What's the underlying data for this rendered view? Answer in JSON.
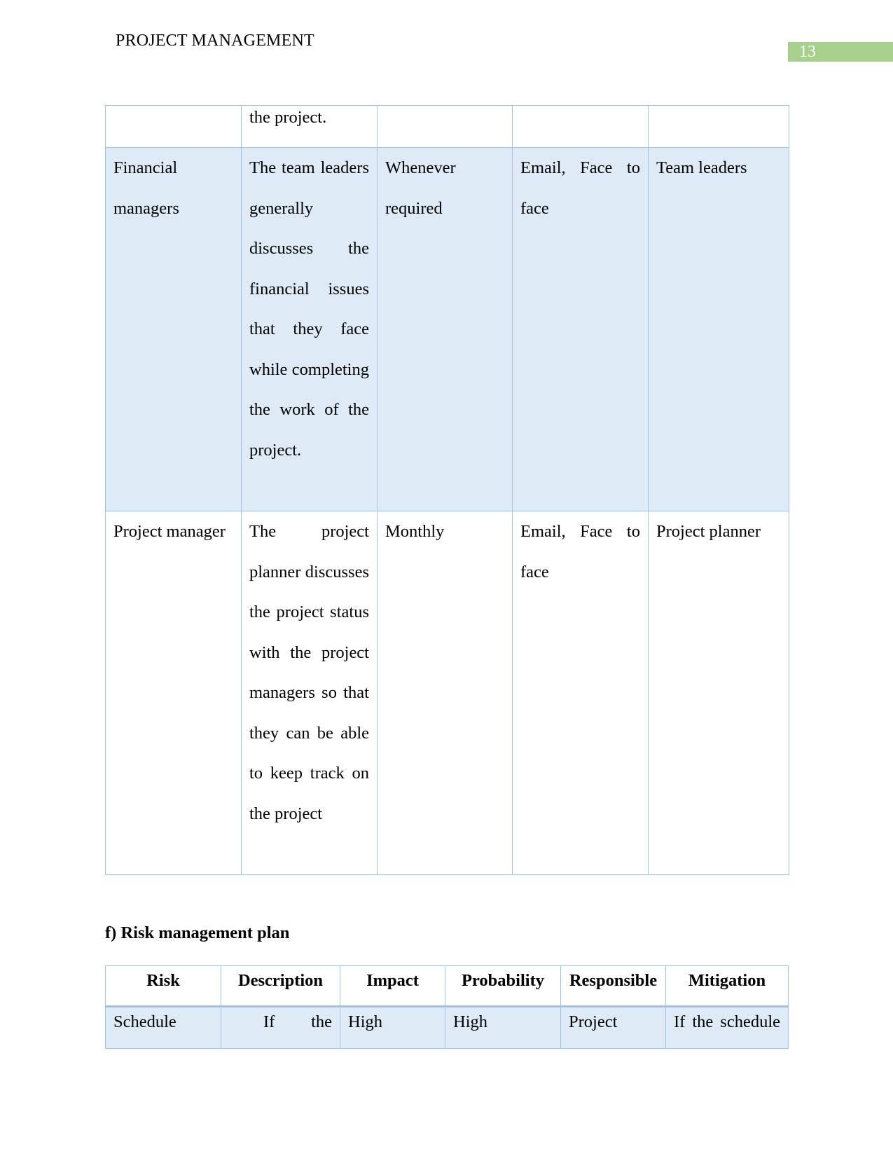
{
  "header": {
    "title": "PROJECT MANAGEMENT",
    "page_number": "13",
    "page_number_bg": "#a8d08d"
  },
  "communication_table": {
    "rows": [
      [
        "",
        "the project.",
        "",
        "",
        ""
      ],
      [
        "Financial managers",
        "The team leaders generally discusses the financial issues that they face while completing the work of the project.",
        "Whenever required",
        "Email, Face to face",
        "Team leaders"
      ],
      [
        "Project manager",
        "The project planner discusses the project status with the project managers so that they can be able to keep track on the project",
        "Monthly",
        "Email, Face to face",
        "Project planner"
      ]
    ]
  },
  "risk_section": {
    "heading": "f) Risk management plan",
    "columns": [
      "Risk",
      "Description",
      "Impact",
      "Probability",
      "Responsible",
      "Mitigation"
    ],
    "rows": [
      [
        "Schedule",
        "If the",
        "High",
        "High",
        "Project",
        "If the schedule"
      ]
    ]
  },
  "colors": {
    "table_border": "#9dc3e6",
    "shaded_row": "#deeaf6"
  }
}
